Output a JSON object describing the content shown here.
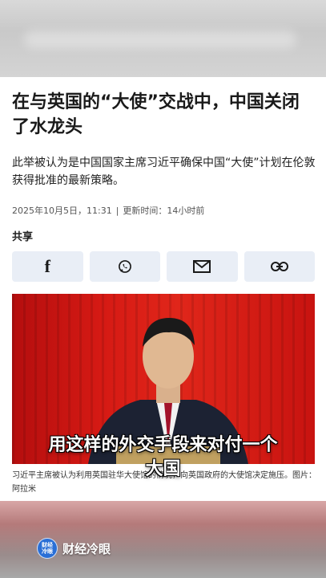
{
  "article": {
    "headline": "在与英国的“大使”交战中，中国关闭了水龙头",
    "summary": "此举被认为是中国国家主席习近平确保中国“大使”计划在伦敦获得批准的最新策略。",
    "date": "2025年10月5日，11:31",
    "updated": "更新时间：14小时前",
    "share_label": "共享",
    "share_buttons": [
      "facebook-icon",
      "whatsapp-icon",
      "email-icon",
      "link-icon"
    ],
    "caption_text": "习近平主席被认为利用英国驻华大使馆的情况，向英国政府的大使馆决定施压。",
    "caption_credit": "图片：阿拉米"
  },
  "video": {
    "subtitle_line1": "用这样的外交手段来对付一个",
    "subtitle_line2": "大国",
    "brand_logo": "财经\n冷眼",
    "brand_name": "财经冷眼"
  },
  "colors": {
    "share_bg": "#e9eef6",
    "photo_red": "#d61a14",
    "brand_blue": "#2a6fd6"
  }
}
